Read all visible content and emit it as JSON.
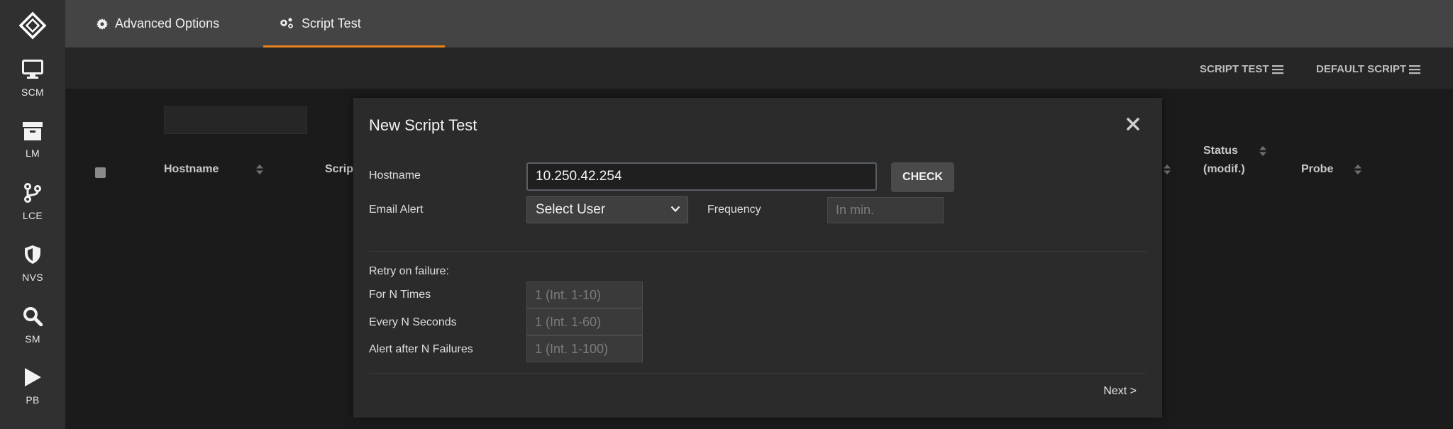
{
  "rail": {
    "items": [
      {
        "label": "SCM",
        "icon": "monitor-icon"
      },
      {
        "label": "LM",
        "icon": "archive-icon"
      },
      {
        "label": "LCE",
        "icon": "branch-icon"
      },
      {
        "label": "NVS",
        "icon": "shield-icon"
      },
      {
        "label": "SM",
        "icon": "search-icon"
      },
      {
        "label": "PB",
        "icon": "play-icon"
      }
    ]
  },
  "tabs": [
    {
      "label": "Advanced Options",
      "icon": "gear-icon",
      "active": false
    },
    {
      "label": "Script Test",
      "icon": "gears-icon",
      "active": true
    }
  ],
  "subbar": {
    "script_test": "SCRIPT TEST",
    "default_script": "DEFAULT SCRIPT"
  },
  "table": {
    "columns": {
      "hostname": "Hostname",
      "script": "Scrip",
      "status_line1": "Status",
      "status_line2": "(modif.)",
      "probe": "Probe"
    }
  },
  "modal": {
    "title": "New Script Test",
    "hostname_label": "Hostname",
    "hostname_value": "10.250.42.254",
    "check_label": "CHECK",
    "email_label": "Email Alert",
    "email_selected": "Select User",
    "frequency_label": "Frequency",
    "frequency_placeholder": "In min.",
    "retry_heading": "Retry on failure:",
    "for_n_times_label": "For N Times",
    "for_n_times_placeholder": "1 (Int. 1-10)",
    "every_n_seconds_label": "Every N Seconds",
    "every_n_seconds_placeholder": "1 (Int. 1-60)",
    "alert_after_label": "Alert after N Failures",
    "alert_after_placeholder": "1 (Int. 1-100)",
    "next_label": "Next >"
  },
  "colors": {
    "accent": "#e8821e",
    "rail_bg": "#303030",
    "topbar_bg": "#444444",
    "modal_bg": "#2b2b2b"
  }
}
